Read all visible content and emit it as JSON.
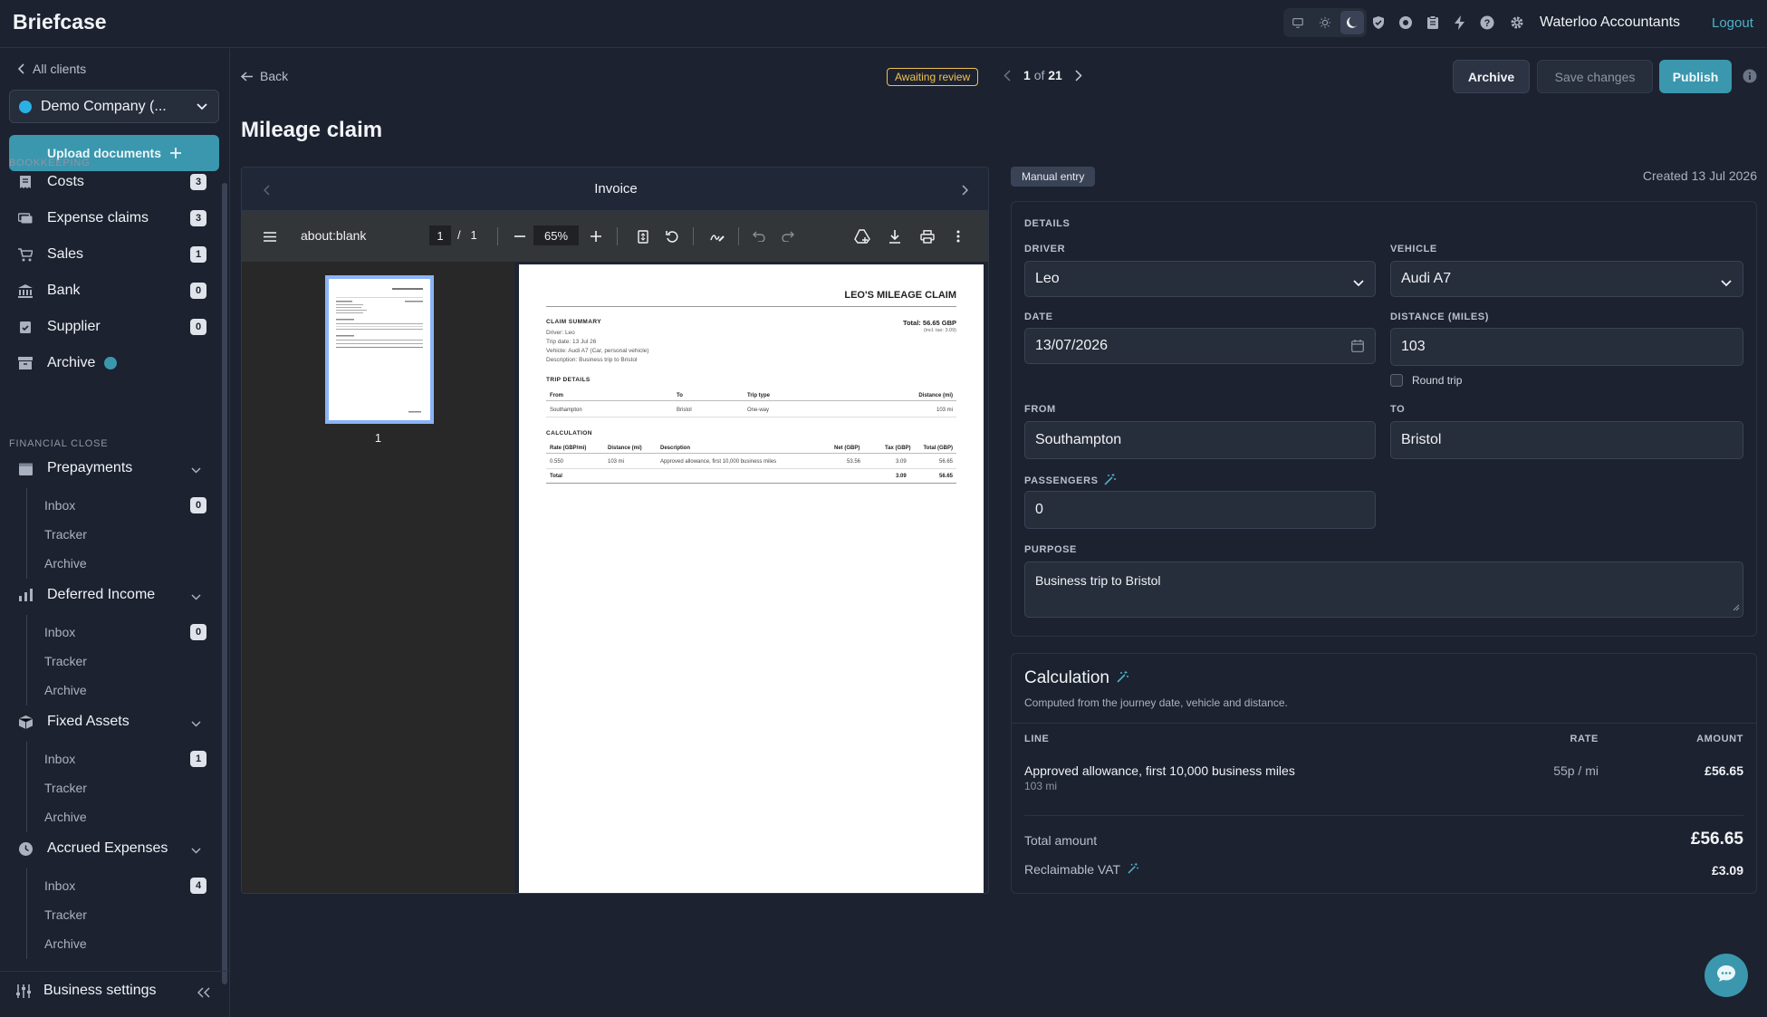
{
  "app": {
    "brand": "Briefcase",
    "org_name": "Waterloo Accountants",
    "logout": "Logout"
  },
  "sidebar": {
    "all_clients": "All clients",
    "company": "Demo Company (...",
    "upload": "Upload documents",
    "bookkeeping_label": "BOOKKEEPING",
    "bookkeeping": [
      {
        "label": "Costs",
        "count": "3"
      },
      {
        "label": "Expense claims",
        "count": "3"
      },
      {
        "label": "Sales",
        "count": "1"
      },
      {
        "label": "Bank",
        "count": "0"
      },
      {
        "label": "Supplier",
        "count": "0"
      },
      {
        "label": "Archive"
      }
    ],
    "financial_close_label": "FINANCIAL CLOSE",
    "groups": [
      {
        "label": "Prepayments",
        "inbox": "Inbox",
        "inbox_count": "0",
        "tracker": "Tracker",
        "archive": "Archive"
      },
      {
        "label": "Deferred Income",
        "inbox": "Inbox",
        "inbox_count": "0",
        "tracker": "Tracker",
        "archive": "Archive"
      },
      {
        "label": "Fixed Assets",
        "inbox": "Inbox",
        "inbox_count": "1",
        "tracker": "Tracker",
        "archive": "Archive"
      },
      {
        "label": "Accrued Expenses",
        "inbox": "Inbox",
        "inbox_count": "4",
        "tracker": "Tracker",
        "archive": "Archive"
      }
    ],
    "business_settings": "Business settings"
  },
  "header": {
    "back": "Back",
    "status": "Awaiting review",
    "pager_current": "1",
    "pager_of": "of",
    "pager_total": "21",
    "archive": "Archive",
    "save": "Save changes",
    "publish": "Publish",
    "title": "Mileage claim"
  },
  "viewer": {
    "title": "Invoice",
    "pdf": {
      "filename": "about:blank",
      "page": "1",
      "page_sep": "/",
      "pages": "1",
      "zoom": "65%",
      "thumb_number": "1"
    },
    "doc": {
      "heading": "LEO'S MILEAGE CLAIM",
      "summary_label": "CLAIM SUMMARY",
      "total": "Total: 56.65 GBP",
      "incl_tax": "(incl. tax: 3.09)",
      "driver": "Driver: Leo",
      "trip_date": "Trip date: 13 Jul 26",
      "vehicle": "Vehicle: Audi A7 (Car, personal vehicle)",
      "description": "Description: Business trip to Bristol",
      "trip_label": "TRIP DETAILS",
      "trip_headers": [
        "From",
        "To",
        "Trip type",
        "Distance (mi)"
      ],
      "trip_row": [
        "Southampton",
        "Bristol",
        "One-way",
        "103 mi"
      ],
      "calc_label": "CALCULATION",
      "calc_headers": [
        "Rate (GBP/mi)",
        "Distance (mi)",
        "Description",
        "Net (GBP)",
        "Tax (GBP)",
        "Total (GBP)"
      ],
      "calc_row": [
        "0.550",
        "103 mi",
        "Approved allowance, first 10,000 business miles",
        "53.56",
        "3.09",
        "56.65"
      ],
      "calc_total": [
        "Total",
        "3.09",
        "56.65"
      ]
    }
  },
  "form": {
    "manual_entry": "Manual entry",
    "created": "Created 13 Jul 2026",
    "details_label": "DETAILS",
    "driver_label": "DRIVER",
    "driver": "Leo",
    "vehicle_label": "VEHICLE",
    "vehicle": "Audi A7",
    "date_label": "DATE",
    "date": "13/07/2026",
    "distance_label": "DISTANCE (MILES)",
    "distance": "103",
    "round_trip": "Round trip",
    "from_label": "FROM",
    "from": "Southampton",
    "to_label": "TO",
    "to": "Bristol",
    "passengers_label": "PASSENGERS",
    "passengers": "0",
    "purpose_label": "PURPOSE",
    "purpose": "Business trip to Bristol"
  },
  "calculation": {
    "title": "Calculation",
    "subtitle": "Computed from the journey date, vehicle and distance.",
    "col_line": "LINE",
    "col_rate": "RATE",
    "col_amount": "AMOUNT",
    "line_desc": "Approved allowance, first 10,000 business miles",
    "line_sub": "103 mi",
    "line_rate": "55p / mi",
    "line_amount": "£56.65",
    "total_label": "Total amount",
    "total": "£56.65",
    "vat_label": "Reclaimable VAT",
    "vat": "£3.09"
  },
  "colors": {
    "accent": "#3a97ae",
    "status": "#f2c14e",
    "link": "#4fb0c6"
  }
}
